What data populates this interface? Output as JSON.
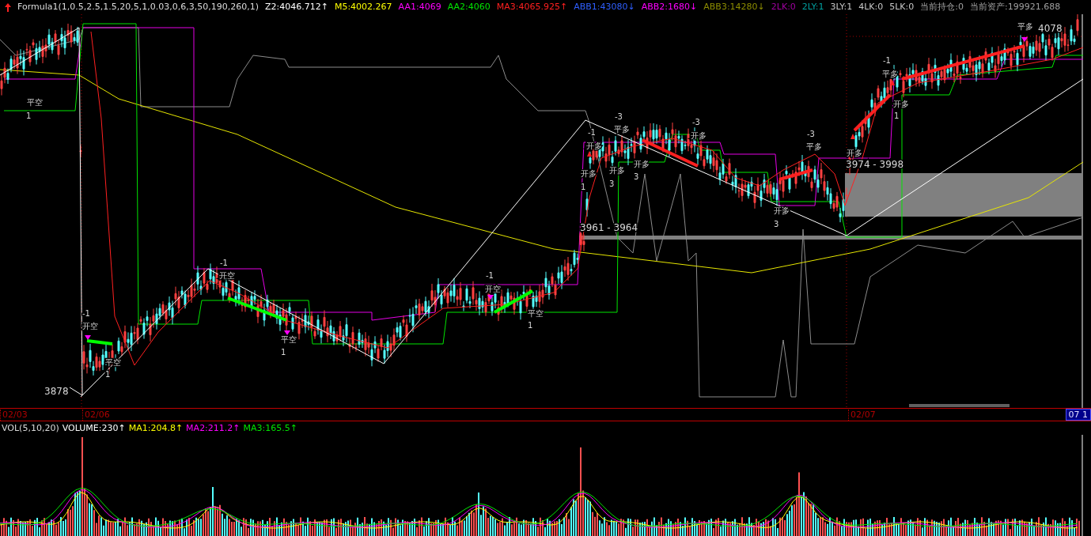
{
  "header": {
    "items": [
      {
        "text": "Formula1(1,0.5,2.5,1.5,20,5,1,0.03,0,6,3,50,190,260,1)",
        "color": "#dcdcdc"
      },
      {
        "text": "Z2:4046.712↑",
        "color": "#ffffff"
      },
      {
        "text": "M5:4002.267",
        "color": "#ffff00"
      },
      {
        "text": "AA1:4069",
        "color": "#ff00ff"
      },
      {
        "text": "AA2:4060",
        "color": "#00e600"
      },
      {
        "text": "MA3:4065.925↑",
        "color": "#ff2020"
      },
      {
        "text": "ABB1:43080↓",
        "color": "#2f5fff"
      },
      {
        "text": "ABB2:1680↓",
        "color": "#ff00ff"
      },
      {
        "text": "ABB3:14280↓",
        "color": "#8c8c00"
      },
      {
        "text": "2LK:0",
        "color": "#a000a0"
      },
      {
        "text": "2LY:1",
        "color": "#00a0a0"
      },
      {
        "text": "3LY:1",
        "color": "#c8c8c8"
      },
      {
        "text": "4LK:0",
        "color": "#c8c8c8"
      },
      {
        "text": "5LK:0",
        "color": "#c8c8c8"
      },
      {
        "text": "当前持仓:0",
        "color": "#a0a0a0"
      },
      {
        "text": "当前资产:199921.688",
        "color": "#a0a0a0"
      }
    ]
  },
  "chart": {
    "annotations": [
      {
        "text": "平空"
      },
      {
        "text": "1"
      },
      {
        "text": "-1"
      },
      {
        "text": "开空"
      },
      {
        "text": "平空"
      },
      {
        "text": "1"
      },
      {
        "text": "3878"
      },
      {
        "text": "-1"
      },
      {
        "text": "开空"
      },
      {
        "text": "平空"
      },
      {
        "text": "1"
      },
      {
        "text": "-1"
      },
      {
        "text": "开空"
      },
      {
        "text": "平空"
      },
      {
        "text": "1"
      },
      {
        "text": "-1"
      },
      {
        "text": "开多"
      },
      {
        "text": "开多"
      },
      {
        "text": "1"
      },
      {
        "text": "-3"
      },
      {
        "text": "平多"
      },
      {
        "text": "开多"
      },
      {
        "text": "3"
      },
      {
        "text": "开多"
      },
      {
        "text": "3"
      },
      {
        "text": "-3"
      },
      {
        "text": "开多"
      },
      {
        "text": "开多"
      },
      {
        "text": "3"
      },
      {
        "text": "-3"
      },
      {
        "text": "平多"
      },
      {
        "text": "3961 - 3964"
      },
      {
        "text": "开多"
      },
      {
        "text": "3974 - 3998"
      },
      {
        "text": "-1"
      },
      {
        "text": "平多"
      },
      {
        "text": "开多"
      },
      {
        "text": "1"
      },
      {
        "text": "平多"
      },
      {
        "text": "4078"
      }
    ]
  },
  "date_axis": {
    "labels": [
      "02/03",
      "02/06",
      "02/07"
    ],
    "cursor": "07 1"
  },
  "volume": {
    "items": [
      {
        "text": "VOL(5,10,20)",
        "color": "#dcdcdc"
      },
      {
        "text": "VOLUME:230↑",
        "color": "#ffffff"
      },
      {
        "text": "MA1:204.8↑",
        "color": "#ffff00"
      },
      {
        "text": "MA2:211.2↑",
        "color": "#ff00ff"
      },
      {
        "text": "MA3:165.5↑",
        "color": "#00e600"
      }
    ]
  }
}
